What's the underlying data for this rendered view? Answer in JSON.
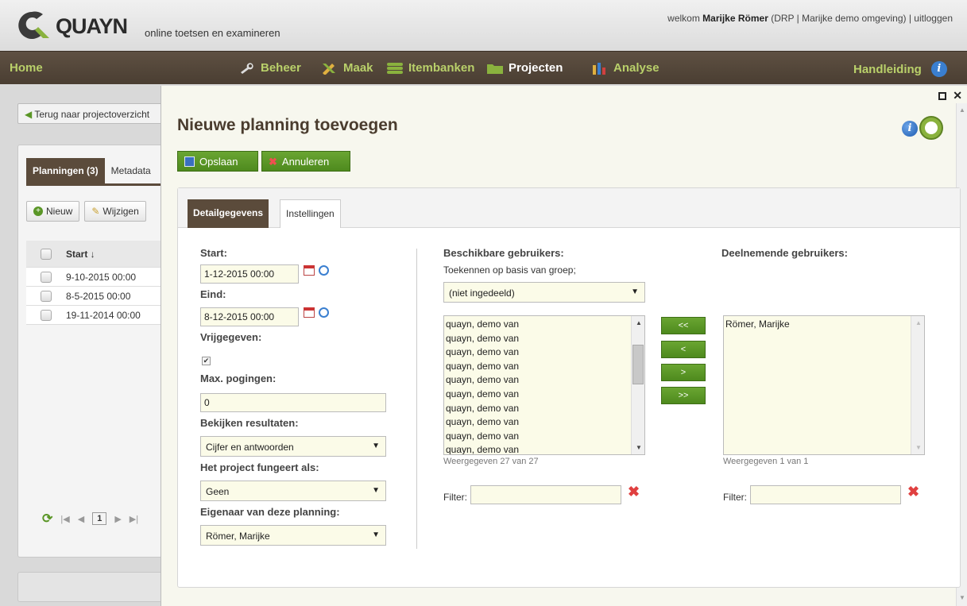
{
  "header": {
    "logo_text": "QUAYN",
    "tagline": "online toetsen en examineren",
    "welcome_prefix": "welkom ",
    "user_name": "Marijke Römer",
    "user_context": " (DRP | Marijke demo omgeving) | ",
    "logout": "uitloggen"
  },
  "nav": {
    "home": "Home",
    "items": [
      {
        "label": "Beheer",
        "icon": "wrench-icon"
      },
      {
        "label": "Maak",
        "icon": "tools-icon"
      },
      {
        "label": "Itembanken",
        "icon": "database-icon"
      },
      {
        "label": "Projecten",
        "icon": "folder-icon"
      },
      {
        "label": "Analyse",
        "icon": "chart-icon"
      }
    ],
    "manual": "Handleiding"
  },
  "background": {
    "back_button": "Terug naar projectoverzicht",
    "tabs": [
      "Planningen (3)",
      "Metadata"
    ],
    "toolbar": [
      "Nieuw",
      "Wijzigen"
    ],
    "grid_header": "Start ↓",
    "rows": [
      "9-10-2015 00:00",
      "8-5-2015 00:00",
      "19-11-2014 00:00"
    ],
    "page": "1"
  },
  "modal": {
    "title": "Nieuwe planning toevoegen",
    "save": "Opslaan",
    "cancel": "Annuleren",
    "tabs": {
      "detail": "Detailgegevens",
      "settings": "Instellingen"
    },
    "form": {
      "start_label": "Start:",
      "start_value": "1-12-2015 00:00",
      "end_label": "Eind:",
      "end_value": "8-12-2015 00:00",
      "released_label": "Vrijgegeven:",
      "released_check": "✔",
      "max_attempts_label": "Max. pogingen:",
      "max_attempts_value": "0",
      "view_results_label": "Bekijken resultaten:",
      "view_results_value": "Cijfer en antwoorden",
      "project_acts_label": "Het project fungeert als:",
      "project_acts_value": "Geen",
      "owner_label": "Eigenaar van deze planning:",
      "owner_value": "Römer, Marijke"
    },
    "available": {
      "title": "Beschikbare gebruikers:",
      "assign_label": "Toekennen op basis van groep;",
      "group_value": "(niet ingedeeld)",
      "items": [
        "quayn, demo van",
        "quayn, demo van",
        "quayn, demo van",
        "quayn, demo van",
        "quayn, demo van",
        "quayn, demo van",
        "quayn, demo van",
        "quayn, demo van",
        "quayn, demo van",
        "quayn, demo van"
      ],
      "caption": "Weergegeven 27 van 27",
      "filter_label": "Filter:"
    },
    "move_buttons": [
      "<<",
      "<",
      ">",
      ">>"
    ],
    "participants": {
      "title": "Deelnemende gebruikers:",
      "items": [
        "Römer, Marijke"
      ],
      "caption": "Weergegeven 1 van 1",
      "filter_label": "Filter:"
    }
  },
  "colors": {
    "nav_bg": "#4f4235",
    "nav_link": "#b9d06a",
    "button_green": "#5a9626",
    "title_brown": "#4a3c2e",
    "clear_red": "#e04040"
  }
}
